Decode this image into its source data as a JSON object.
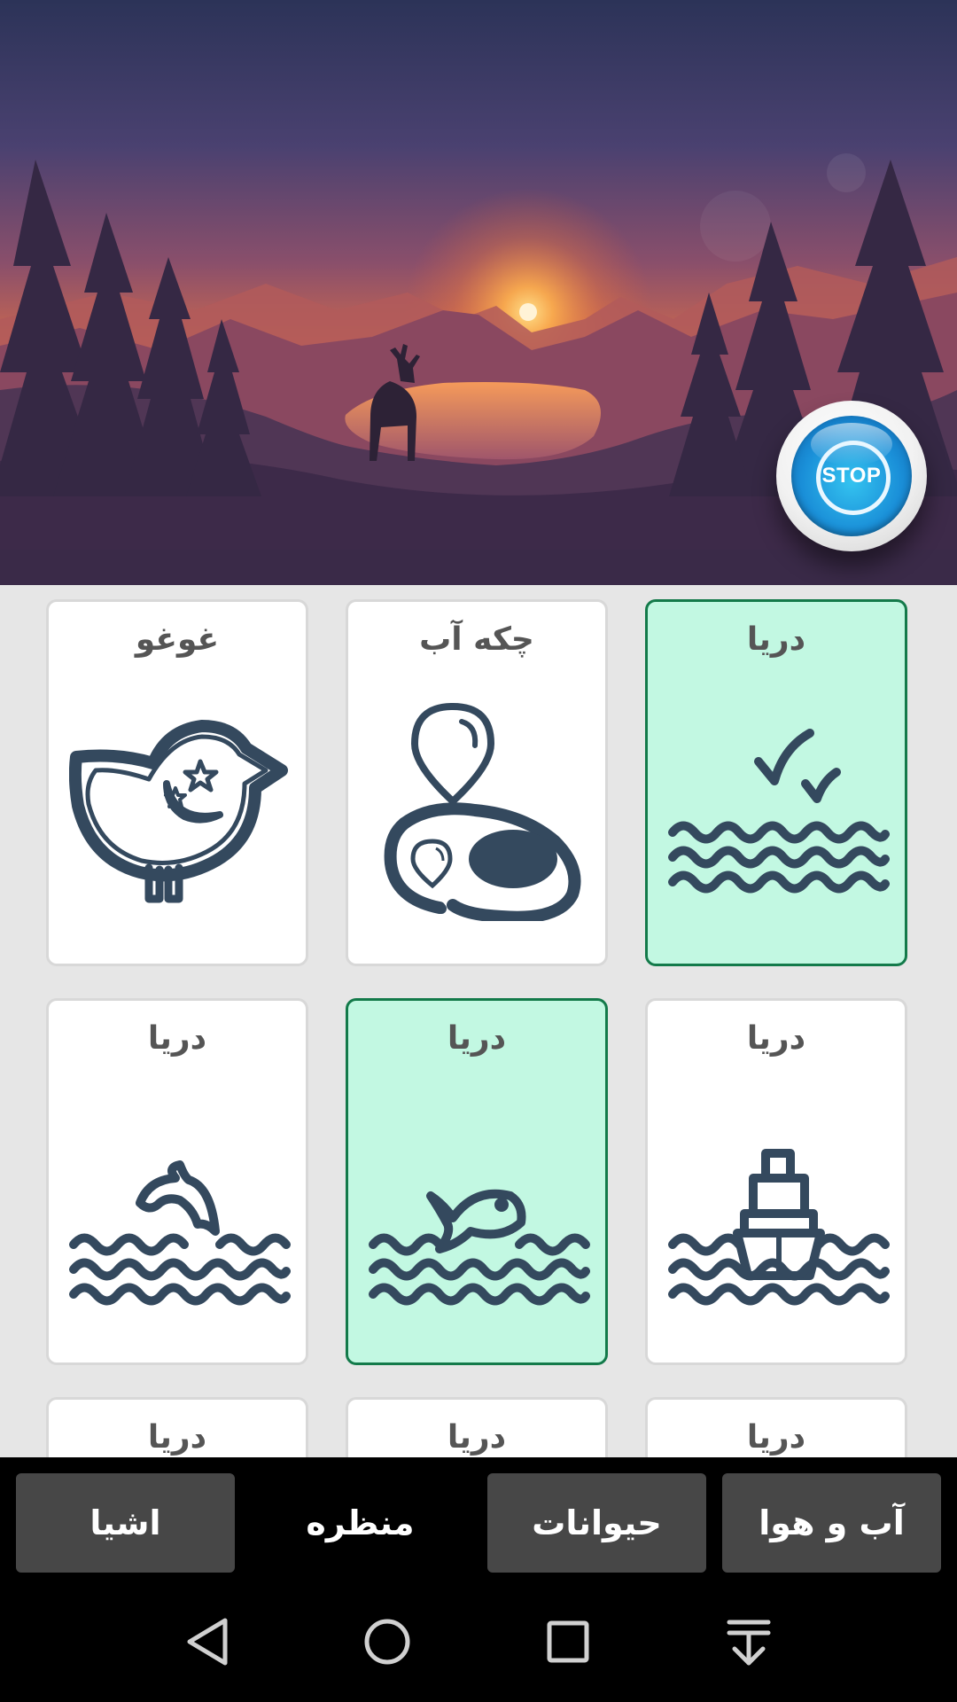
{
  "hero": {
    "stop_label": "STOP"
  },
  "cards": [
    {
      "title": "دریا",
      "icon": "sea-birds-icon",
      "selected": true
    },
    {
      "title": "چکه آب",
      "icon": "water-drop-icon",
      "selected": false
    },
    {
      "title": "غوغو",
      "icon": "bird-icon",
      "selected": false
    },
    {
      "title": "دریا",
      "icon": "ship-icon",
      "selected": false
    },
    {
      "title": "دریا",
      "icon": "fish-waves-icon",
      "selected": true
    },
    {
      "title": "دریا",
      "icon": "dolphin-icon",
      "selected": false
    },
    {
      "title": "دریا",
      "icon": "waves-icon",
      "selected": false
    },
    {
      "title": "دریا",
      "icon": "waves-icon",
      "selected": false
    },
    {
      "title": "دریا",
      "icon": "waves-icon",
      "selected": false
    }
  ],
  "tabs": [
    {
      "label": "آب و هوا",
      "active": false
    },
    {
      "label": "حیوانات",
      "active": false
    },
    {
      "label": "منظره",
      "active": true
    },
    {
      "label": "اشیا",
      "active": false
    }
  ],
  "navbar": {
    "icons": [
      "back-icon",
      "home-icon",
      "recents-icon",
      "notifications-pull-icon"
    ]
  },
  "colors": {
    "selected_card_bg": "#c2f8e2",
    "selected_card_border": "#137a4a",
    "icon_color": "#34495e",
    "tab_inactive_bg": "#474747"
  }
}
